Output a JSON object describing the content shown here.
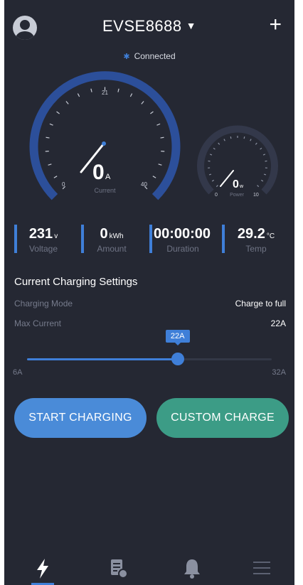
{
  "header": {
    "device_name": "EVSE8688",
    "caret": "▼",
    "add_glyph": "+",
    "connection_status": "Connected",
    "bluetooth_glyph": "✱"
  },
  "gauges": {
    "current": {
      "value": "0",
      "unit": "A",
      "label": "Current",
      "min": "0",
      "mid": "21",
      "max": "40",
      "needle_value": 0
    },
    "power": {
      "value": "0",
      "unit": "w",
      "label": "Power",
      "min": "0",
      "max": "10",
      "needle_value": 0
    }
  },
  "stats": [
    {
      "value": "231",
      "unit": "v",
      "label": "Voltage"
    },
    {
      "value": "0",
      "unit": "kWh",
      "label": "Amount"
    },
    {
      "value": "00:00:00",
      "unit": "",
      "label": "Duration"
    },
    {
      "value": "29.2",
      "unit": "°C",
      "label": "Temp"
    }
  ],
  "settings": {
    "title": "Current Charging Settings",
    "mode_label": "Charging Mode",
    "mode_value": "Charge to full",
    "max_current_label": "Max Current",
    "max_current_value": "22A",
    "slider": {
      "tooltip": "22A",
      "min_label": "6A",
      "max_label": "32A",
      "min": 6,
      "max": 32,
      "value": 22
    }
  },
  "actions": {
    "start_label": "START CHARGING",
    "custom_label": "CUSTOM CHARGE"
  },
  "tabs": [
    {
      "icon": "lightning-icon",
      "active": true
    },
    {
      "icon": "report-icon",
      "active": false
    },
    {
      "icon": "bell-icon",
      "active": false
    },
    {
      "icon": "menu-icon",
      "active": false
    }
  ],
  "colors": {
    "background": "#252833",
    "accent_blue": "#3f7fd8",
    "start_button": "#4a8bd8",
    "custom_button": "#3c9c86"
  }
}
